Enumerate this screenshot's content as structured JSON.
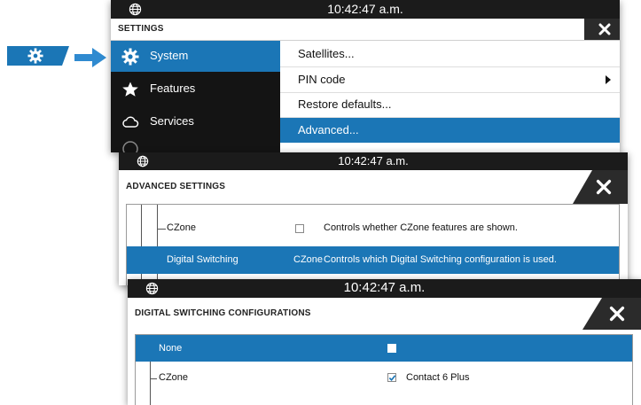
{
  "callout": {
    "icon": "gear-icon",
    "arrow_icon": "arrow-right-icon",
    "accent": "#1b76b6"
  },
  "settings_panel": {
    "status_time": "10:42:47 a.m.",
    "title": "SETTINGS",
    "close_icon": "close-icon",
    "sidebar": [
      {
        "label": "System",
        "icon": "gear-icon",
        "active": true
      },
      {
        "label": "Features",
        "icon": "star-icon",
        "active": false
      },
      {
        "label": "Services",
        "icon": "cloud-icon",
        "active": false
      }
    ],
    "menu": [
      {
        "label": "Satellites...",
        "has_submenu": false,
        "active": false
      },
      {
        "label": "PIN code",
        "has_submenu": true,
        "active": false
      },
      {
        "label": "Restore defaults...",
        "has_submenu": false,
        "active": false
      },
      {
        "label": "Advanced...",
        "has_submenu": false,
        "active": true
      }
    ]
  },
  "advanced_panel": {
    "status_time": "10:42:47 a.m.",
    "title": "ADVANCED SETTINGS",
    "rows": [
      {
        "name": "CZone",
        "value": "",
        "checked": false,
        "description": "Controls whether CZone features are shown.",
        "active": false
      },
      {
        "name": "Digital Switching",
        "value": "CZone",
        "description": "Controls which Digital Switching configuration is used.",
        "active": true
      }
    ]
  },
  "digital_panel": {
    "status_time": "10:42:47 a.m.",
    "title": "DIGITAL SWITCHING CONFIGURATIONS",
    "rows": [
      {
        "name": "None",
        "checked": false,
        "value": "",
        "active": true
      },
      {
        "name": "CZone",
        "checked": true,
        "value": "Contact 6 Plus",
        "active": false
      }
    ]
  }
}
